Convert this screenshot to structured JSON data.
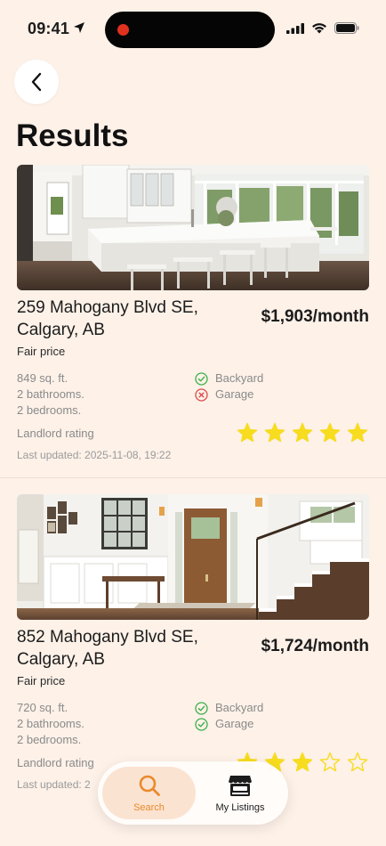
{
  "status_bar": {
    "time": "09:41"
  },
  "header": {
    "title": "Results"
  },
  "listings": [
    {
      "address": "259 Mahogany Blvd SE, Calgary, AB",
      "price": "$1,903/month",
      "price_tag": "Fair price",
      "specs": [
        "849 sq. ft.",
        "2 bathrooms.",
        "2 bedrooms."
      ],
      "features": [
        {
          "label": "Backyard",
          "available": true
        },
        {
          "label": "Garage",
          "available": false
        }
      ],
      "rating_label": "Landlord rating",
      "rating": 5,
      "rating_max": 5,
      "last_updated": "Last updated: 2025-11-08, 19:22"
    },
    {
      "address": "852 Mahogany Blvd SE, Calgary, AB",
      "price": "$1,724/month",
      "price_tag": "Fair price",
      "specs": [
        "720 sq. ft.",
        "2 bathrooms.",
        "2 bedrooms."
      ],
      "features": [
        {
          "label": "Backyard",
          "available": true
        },
        {
          "label": "Garage",
          "available": true
        }
      ],
      "rating_label": "Landlord rating",
      "rating": 3,
      "rating_max": 5,
      "last_updated": "Last updated: 2"
    }
  ],
  "tabbar": {
    "search_label": "Search",
    "listings_label": "My Listings"
  },
  "colors": {
    "background": "#fdf1e8",
    "accent": "#ea8a2c",
    "star": "#f7dc1f",
    "check_green": "#3cb04a",
    "cross_red": "#dd4a4a"
  },
  "icons": {
    "back": "chevron-left-icon",
    "search": "search-icon",
    "listings": "storefront-icon",
    "feature_yes": "check-circle-icon",
    "feature_no": "cross-circle-icon",
    "star": "star-icon"
  }
}
